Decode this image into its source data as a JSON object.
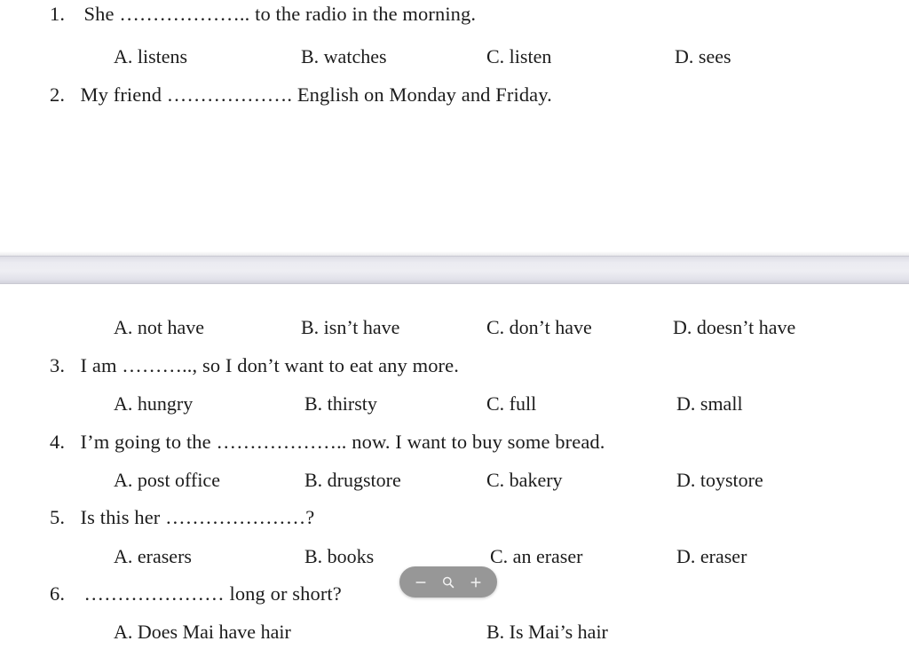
{
  "document": {
    "type": "scanned-worksheet",
    "background_color": "#ffffff",
    "text_color": "#1c1c1c",
    "page_gap_color": "#e9e9ef"
  },
  "pages": [
    {
      "page_number": 1,
      "blocks": [
        {
          "kind": "question",
          "number": "1.",
          "text": "She ……………….. to the radio in the morning."
        },
        {
          "kind": "options",
          "options": [
            {
              "letter": "A.",
              "text": "listens"
            },
            {
              "letter": "B.",
              "text": "watches"
            },
            {
              "letter": "C.",
              "text": "listen"
            },
            {
              "letter": "D.",
              "text": "sees"
            }
          ]
        },
        {
          "kind": "question",
          "number": "2.",
          "text": "My friend ………………. English on Monday and Friday."
        }
      ]
    },
    {
      "page_number": 2,
      "blocks": [
        {
          "kind": "options",
          "options": [
            {
              "letter": "A.",
              "text": "not have"
            },
            {
              "letter": "B.",
              "text": "isn’t have"
            },
            {
              "letter": "C.",
              "text": "don’t have"
            },
            {
              "letter": "D.",
              "text": "doesn’t have"
            }
          ]
        },
        {
          "kind": "question",
          "number": "3.",
          "text": "I am  ……….., so I don’t want to eat any more."
        },
        {
          "kind": "options",
          "options": [
            {
              "letter": "A.",
              "text": "hungry"
            },
            {
              "letter": "B.",
              "text": "thirsty"
            },
            {
              "letter": "C.",
              "text": "full"
            },
            {
              "letter": "D.",
              "text": "small"
            }
          ]
        },
        {
          "kind": "question",
          "number": "4.",
          "text": "I’m going to the ……………….. now. I want to buy some bread."
        },
        {
          "kind": "options",
          "options": [
            {
              "letter": "A.",
              "text": "post office"
            },
            {
              "letter": "B.",
              "text": "drugstore"
            },
            {
              "letter": "C.",
              "text": "bakery"
            },
            {
              "letter": "D.",
              "text": "toystore"
            }
          ]
        },
        {
          "kind": "question",
          "number": "5.",
          "text": "Is this her …………………?"
        },
        {
          "kind": "options",
          "options": [
            {
              "letter": "A.",
              "text": "erasers"
            },
            {
              "letter": "B.",
              "text": "books"
            },
            {
              "letter": "C.",
              "text": "an eraser"
            },
            {
              "letter": "D.",
              "text": "eraser"
            }
          ]
        },
        {
          "kind": "question",
          "number": "6.",
          "text": "………………… long or short?"
        },
        {
          "kind": "options",
          "options": [
            {
              "letter": "A.",
              "text": "Does Mai have hair"
            },
            {
              "letter": "B.",
              "text": "Is Mai’s hair"
            }
          ]
        }
      ]
    }
  ],
  "lines": {
    "q1": "1.  She ……………….. to the radio in the morning.",
    "q1_num": "1.",
    "q1_body": "She ……………….. to the radio in the morning.",
    "q1_a": "A. listens",
    "q1_b": "B. watches",
    "q1_c": "C. listen",
    "q1_d": "D. sees",
    "q2_num": "2.",
    "q2_body": "My friend ………………. English on Monday and Friday.",
    "q2_a": "A. not have",
    "q2_b": "B. isn’t have",
    "q2_c": "C. don’t have",
    "q2_d": "D. doesn’t have",
    "q3_num": "3.",
    "q3_body": "I am  ……….., so I don’t want to eat any more.",
    "q3_a": "A. hungry",
    "q3_b": "B. thirsty",
    "q3_c": "C. full",
    "q3_d": "D. small",
    "q4_num": "4.",
    "q4_body": "I’m going to the ……………….. now. I want to buy some bread.",
    "q4_a": "A. post office",
    "q4_b": "B. drugstore",
    "q4_c": "C. bakery",
    "q4_d": "D. toystore",
    "q5_num": "5.",
    "q5_body": "Is this her …………………?",
    "q5_a": "A. erasers",
    "q5_b": "B. books",
    "q5_c": "C. an eraser",
    "q5_d": "D. eraser",
    "q6_num": "6.",
    "q6_body": "………………… long or short?",
    "q6_a": "A. Does Mai have hair",
    "q6_b": "B. Is Mai’s hair"
  },
  "zoom_control": {
    "background_color": "#979797",
    "icon_color": "#f2f2f2",
    "zoom_out_label": "−",
    "zoom_out_icon": "minus-icon",
    "zoom_reset_icon": "magnifier-icon",
    "zoom_in_label": "+",
    "zoom_in_icon": "plus-icon"
  }
}
